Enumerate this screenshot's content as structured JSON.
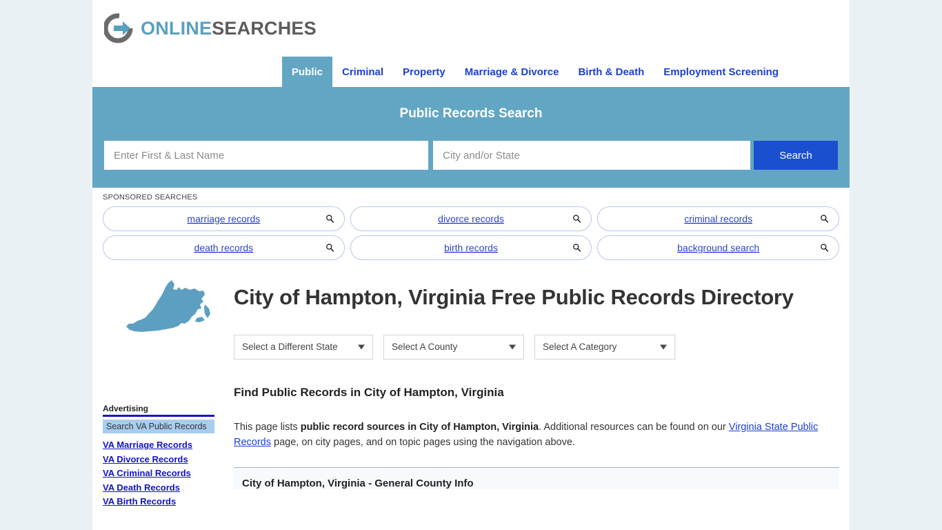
{
  "site": {
    "logo_primary": "ONLINE",
    "logo_secondary": "SEARCHES",
    "accent_teal": "#63a6c4",
    "accent_blue": "#1b3fd4",
    "button_blue": "#1a4fd0"
  },
  "nav": {
    "items": [
      {
        "label": "Public",
        "active": true
      },
      {
        "label": "Criminal",
        "active": false
      },
      {
        "label": "Property",
        "active": false
      },
      {
        "label": "Marriage & Divorce",
        "active": false
      },
      {
        "label": "Birth & Death",
        "active": false
      },
      {
        "label": "Employment Screening",
        "active": false
      }
    ]
  },
  "hero": {
    "title": "Public Records Search",
    "name_placeholder": "Enter First & Last Name",
    "name_value": "",
    "city_placeholder": "City and/or State",
    "city_value": "",
    "button_label": "Search"
  },
  "sponsored": {
    "label": "SPONSORED SEARCHES",
    "row1": [
      {
        "label": "marriage records",
        "icon": "search-icon"
      },
      {
        "label": "divorce records",
        "icon": "search-icon"
      },
      {
        "label": "criminal records",
        "icon": "search-icon"
      }
    ],
    "row2": [
      {
        "label": "death records",
        "icon": "search-icon"
      },
      {
        "label": "birth records",
        "icon": "search-icon"
      },
      {
        "label": "background search",
        "icon": "search-icon"
      }
    ]
  },
  "sidebar": {
    "map_icon": "virginia-state-map-icon",
    "advertising_label": "Advertising",
    "ad_header": "Search VA Public Records",
    "ad_links": [
      "VA Marriage Records",
      "VA Divorce Records",
      "VA Criminal Records",
      "VA Death Records",
      "VA Birth Records"
    ]
  },
  "main": {
    "title": "City of Hampton, Virginia Free Public Records Directory",
    "selects": [
      {
        "label": "Select a Different State"
      },
      {
        "label": "Select A County"
      },
      {
        "label": "Select A Category"
      }
    ],
    "section_heading": "Find Public Records in City of Hampton, Virginia",
    "paragraph": {
      "part1": "This page lists ",
      "bold1": "public record sources in City of Hampton, Virginia",
      "part2": ". Additional resources can be found on our ",
      "link1": "Virginia State Public Records",
      "part3": " page, on city pages, and on topic pages using the navigation above."
    },
    "info_title": "City of Hampton, Virginia - General County Info"
  }
}
